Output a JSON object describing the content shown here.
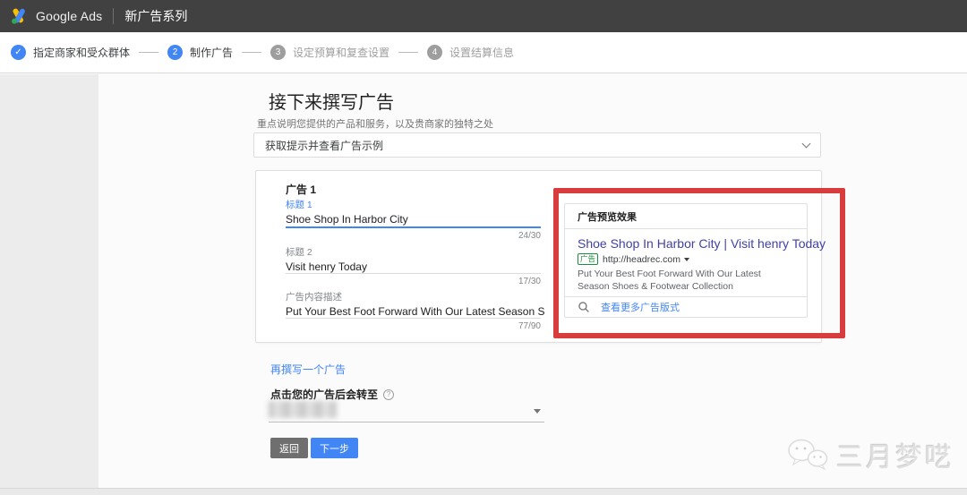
{
  "topbar": {
    "brand": "Google Ads",
    "title": "新广告系列"
  },
  "stepper": {
    "steps": [
      {
        "num": "",
        "label": "指定商家和受众群体",
        "state": "done"
      },
      {
        "num": "2",
        "label": "制作广告",
        "state": "active"
      },
      {
        "num": "3",
        "label": "设定预算和复查设置",
        "state": "pending"
      },
      {
        "num": "4",
        "label": "设置结算信息",
        "state": "pending"
      }
    ]
  },
  "main": {
    "heading": "接下来撰写广告",
    "subheading": "重点说明您提供的产品和服务，以及贵商家的独特之处",
    "tips_dropdown_label": "获取提示并查看广告示例",
    "ad_card": {
      "title": "广告 1",
      "fields": [
        {
          "label": "标题 1",
          "value": "Shoe Shop In Harbor City",
          "counter": "24/30"
        },
        {
          "label": "标题 2",
          "value": "Visit henry Today",
          "counter": "17/30"
        },
        {
          "label": "广告内容描述",
          "value": "Put Your Best Foot Forward With Our Latest Season Shoes & Footwear Collec",
          "counter": "77/90"
        }
      ]
    },
    "preview": {
      "header": "广告预览效果",
      "ad_title": "Shoe Shop In Harbor City | Visit henry Today",
      "ad_badge": "广告",
      "ad_url": "http://headrec.com",
      "ad_description": "Put Your Best Foot Forward With Our Latest Season Shoes & Footwear Collection",
      "more_formats_label": "查看更多广告版式"
    },
    "add_ad_link": "再撰写一个广告",
    "destination_label": "点击您的广告后会转至",
    "back_button": "返回",
    "next_button": "下一步"
  },
  "watermark": "三月梦呓",
  "icons": {
    "check": "✓",
    "help": "?"
  },
  "colors": {
    "accent_blue": "#4285f4",
    "highlight_red": "#d93c3c",
    "badge_green": "#1e8e3e",
    "ad_title_indigo": "#4141a7",
    "topbar_grey": "#414141"
  }
}
